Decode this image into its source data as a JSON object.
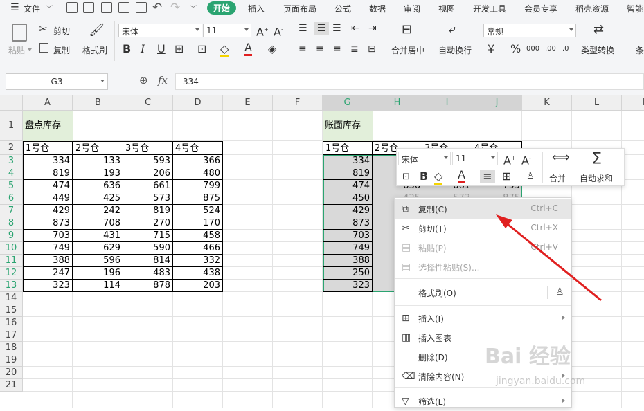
{
  "menubar": {
    "file_label": "文件",
    "tabs": [
      "开始",
      "插入",
      "页面布局",
      "公式",
      "数据",
      "审阅",
      "视图",
      "开发工具",
      "会员专享",
      "稻壳资源",
      "智能"
    ]
  },
  "ribbon": {
    "paste": "粘贴",
    "cut": "剪切",
    "copy": "复制",
    "format_painter": "格式刷",
    "font_name": "宋体",
    "font_size": "11",
    "merge_center": "合并居中",
    "wrap_text": "自动换行",
    "number_format": "常规",
    "type_convert": "类型转换",
    "more": "条"
  },
  "formula_bar": {
    "name_box": "G3",
    "fx": "fx",
    "value": "334"
  },
  "columns": [
    "A",
    "B",
    "C",
    "D",
    "E",
    "F",
    "G",
    "H",
    "I",
    "J",
    "K",
    "L",
    "M"
  ],
  "rows": [
    "1",
    "2",
    "3",
    "4",
    "5",
    "6",
    "7",
    "8",
    "9",
    "10",
    "11",
    "12",
    "13",
    "14",
    "15",
    "16",
    "17",
    "18",
    "19",
    "20",
    "21"
  ],
  "left_table": {
    "title": "盘点库存",
    "headers": [
      "1号仓",
      "2号仓",
      "3号仓",
      "4号仓"
    ],
    "rows": [
      [
        "334",
        "133",
        "593",
        "366"
      ],
      [
        "819",
        "193",
        "206",
        "480"
      ],
      [
        "474",
        "636",
        "661",
        "799"
      ],
      [
        "449",
        "425",
        "573",
        "875"
      ],
      [
        "429",
        "242",
        "819",
        "524"
      ],
      [
        "873",
        "708",
        "270",
        "170"
      ],
      [
        "703",
        "431",
        "715",
        "458"
      ],
      [
        "749",
        "629",
        "590",
        "466"
      ],
      [
        "388",
        "596",
        "814",
        "332"
      ],
      [
        "247",
        "196",
        "483",
        "438"
      ],
      [
        "323",
        "114",
        "878",
        "203"
      ]
    ]
  },
  "right_table": {
    "title": "账面库存",
    "headers": [
      "1号仓",
      "2号仓",
      "3号仓",
      "4号仓"
    ],
    "g_values": [
      "334",
      "819",
      "474",
      "450",
      "429",
      "873",
      "703",
      "749",
      "388",
      "250",
      "323"
    ],
    "row5_partial": [
      "636",
      "661",
      "799"
    ],
    "row6_partial": [
      "425",
      "573",
      "875"
    ]
  },
  "float_toolbar": {
    "font_name": "宋体",
    "font_size": "11",
    "merge": "合并",
    "autosum": "自动求和"
  },
  "context_menu": {
    "items": [
      {
        "label": "复制(C)",
        "shortcut": "Ctrl+C"
      },
      {
        "label": "剪切(T)",
        "shortcut": "Ctrl+X"
      },
      {
        "label": "粘贴(P)",
        "shortcut": "Ctrl+V"
      },
      {
        "label": "选择性粘贴(S)..."
      },
      {
        "label": "格式刷(O)"
      },
      {
        "label": "插入(I)"
      },
      {
        "label": "插入图表"
      },
      {
        "label": "删除(D)"
      },
      {
        "label": "清除内容(N)"
      },
      {
        "label": "筛选(L)"
      }
    ]
  },
  "watermark": {
    "brand": "Bai 经验",
    "url": "jingyan.baidu.com"
  },
  "colors": {
    "accent": "#2ba471",
    "arrow": "#e02020",
    "header_fill": "#e2efda",
    "selected_fill": "#d9d9d9"
  }
}
